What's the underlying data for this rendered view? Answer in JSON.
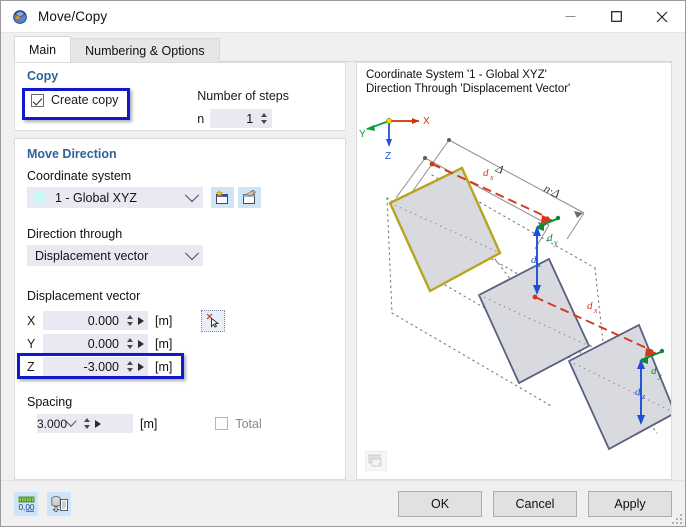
{
  "window": {
    "title": "Move/Copy",
    "app_icon": "move-copy-icon",
    "minimize": "–",
    "maximize": "□",
    "close": "✕"
  },
  "tabs": [
    {
      "label": "Main",
      "active": true
    },
    {
      "label": "Numbering & Options",
      "active": false
    }
  ],
  "copy_group": {
    "title": "Copy",
    "create_copy_label": "Create copy",
    "create_copy_checked": true,
    "steps_title": "Number of steps",
    "steps_prefix": "n",
    "steps_value": "1",
    "highlight_color": "#1018d0"
  },
  "move_direction": {
    "title": "Move Direction",
    "coordinate_system_label": "Coordinate system",
    "coordinate_system_value": "1 - Global XYZ",
    "coordinate_system_swatch": "#ccf6f6",
    "new_cs_icon": "new-coordinate-system-icon",
    "edit_cs_icon": "edit-coordinate-system-icon",
    "direction_through_label": "Direction through",
    "direction_through_value": "Displacement vector",
    "displacement_label": "Displacement vector",
    "pick_icon": "pick-point-icon",
    "vector": [
      {
        "axis": "X",
        "value": "0.000",
        "unit": "[m]",
        "highlighted": false
      },
      {
        "axis": "Y",
        "value": "0.000",
        "unit": "[m]",
        "highlighted": false
      },
      {
        "axis": "Z",
        "value": "-3.000",
        "unit": "[m]",
        "highlighted": true
      }
    ],
    "spacing_label": "Spacing",
    "spacing_value": "3.000",
    "spacing_unit": "[m]",
    "total_label": "Total",
    "total_checked": false,
    "total_disabled": true
  },
  "preview": {
    "caption": "Coordinate System '1 - Global XYZ'\nDirection Through 'Displacement Vector'",
    "snapshot_icon": "snapshot-icon",
    "axes": [
      {
        "name": "X",
        "color": "#cc3300"
      },
      {
        "name": "Y",
        "color": "#00a03c"
      },
      {
        "name": "Z",
        "color": "#2050dd"
      }
    ],
    "annotations": [
      {
        "text": "Δ",
        "kind": "dimension"
      },
      {
        "text": "n·Δ",
        "kind": "dimension"
      },
      {
        "text": "dₓ",
        "kind": "vector-x",
        "color": "#d6361b"
      },
      {
        "text": "dᵧ",
        "kind": "vector-y",
        "color": "#0a8a33"
      },
      {
        "text": "dꟳ",
        "kind": "vector-z",
        "color": "#1d4fd6"
      }
    ],
    "vector_labels": {
      "dx": "d",
      "dx_sub": "x",
      "dy": "d",
      "dy_sub": "y",
      "dz": "d",
      "dz_sub": "z"
    },
    "delta_label": "Δ",
    "ndelta_label": "n·Δ",
    "original_outline_color": "#b8a51e",
    "copy_outline_color": "#5a5f82",
    "shape_fill": "#d9d9e0"
  },
  "footer": {
    "decimals_icon": "decimal-places-icon",
    "decimals_icon_label": "0,00",
    "settings_icon": "import-settings-icon",
    "buttons": [
      {
        "label": "OK",
        "name": "ok-button"
      },
      {
        "label": "Cancel",
        "name": "cancel-button"
      },
      {
        "label": "Apply",
        "name": "apply-button"
      }
    ]
  }
}
